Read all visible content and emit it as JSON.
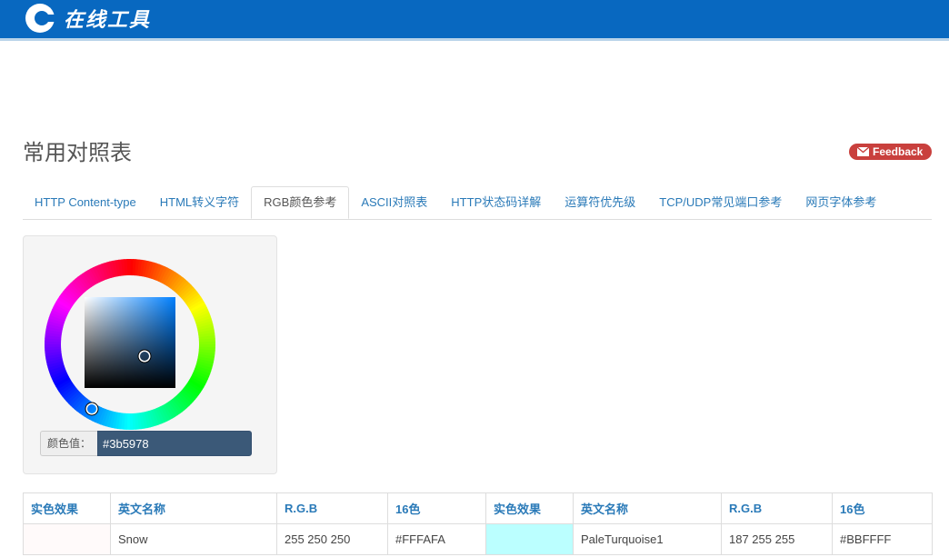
{
  "header": {
    "logo_text": "在线工具",
    "brand_color": "#0868c0"
  },
  "page": {
    "title": "常用对照表"
  },
  "feedback": {
    "label": "Feedback",
    "color": "#c9403d"
  },
  "tabs": [
    {
      "label": "HTTP Content-type",
      "active": false
    },
    {
      "label": "HTML转义字符",
      "active": false
    },
    {
      "label": "RGB颜色参考",
      "active": true
    },
    {
      "label": "ASCII对照表",
      "active": false
    },
    {
      "label": "HTTP状态码详解",
      "active": false
    },
    {
      "label": "运算符优先级",
      "active": false
    },
    {
      "label": "TCP/UDP常见端口参考",
      "active": false
    },
    {
      "label": "网页字体参考",
      "active": false
    }
  ],
  "picker": {
    "value_label": "颜色值：",
    "value": "#3b5978",
    "selected_color": "#3b5978",
    "hue_square_color": "#0080ff"
  },
  "table": {
    "headers": [
      "实色效果",
      "英文名称",
      "R.G.B",
      "16色",
      "实色效果",
      "英文名称",
      "R.G.B",
      "16色"
    ],
    "rows": [
      {
        "left": {
          "swatch": "#FFFAFA",
          "name": "Snow",
          "rgb": "255 250 250",
          "hex": "#FFFAFA"
        },
        "right": {
          "swatch": "#BBFFFF",
          "name": "PaleTurquoise1",
          "rgb": "187 255 255",
          "hex": "#BBFFFF"
        }
      }
    ]
  }
}
